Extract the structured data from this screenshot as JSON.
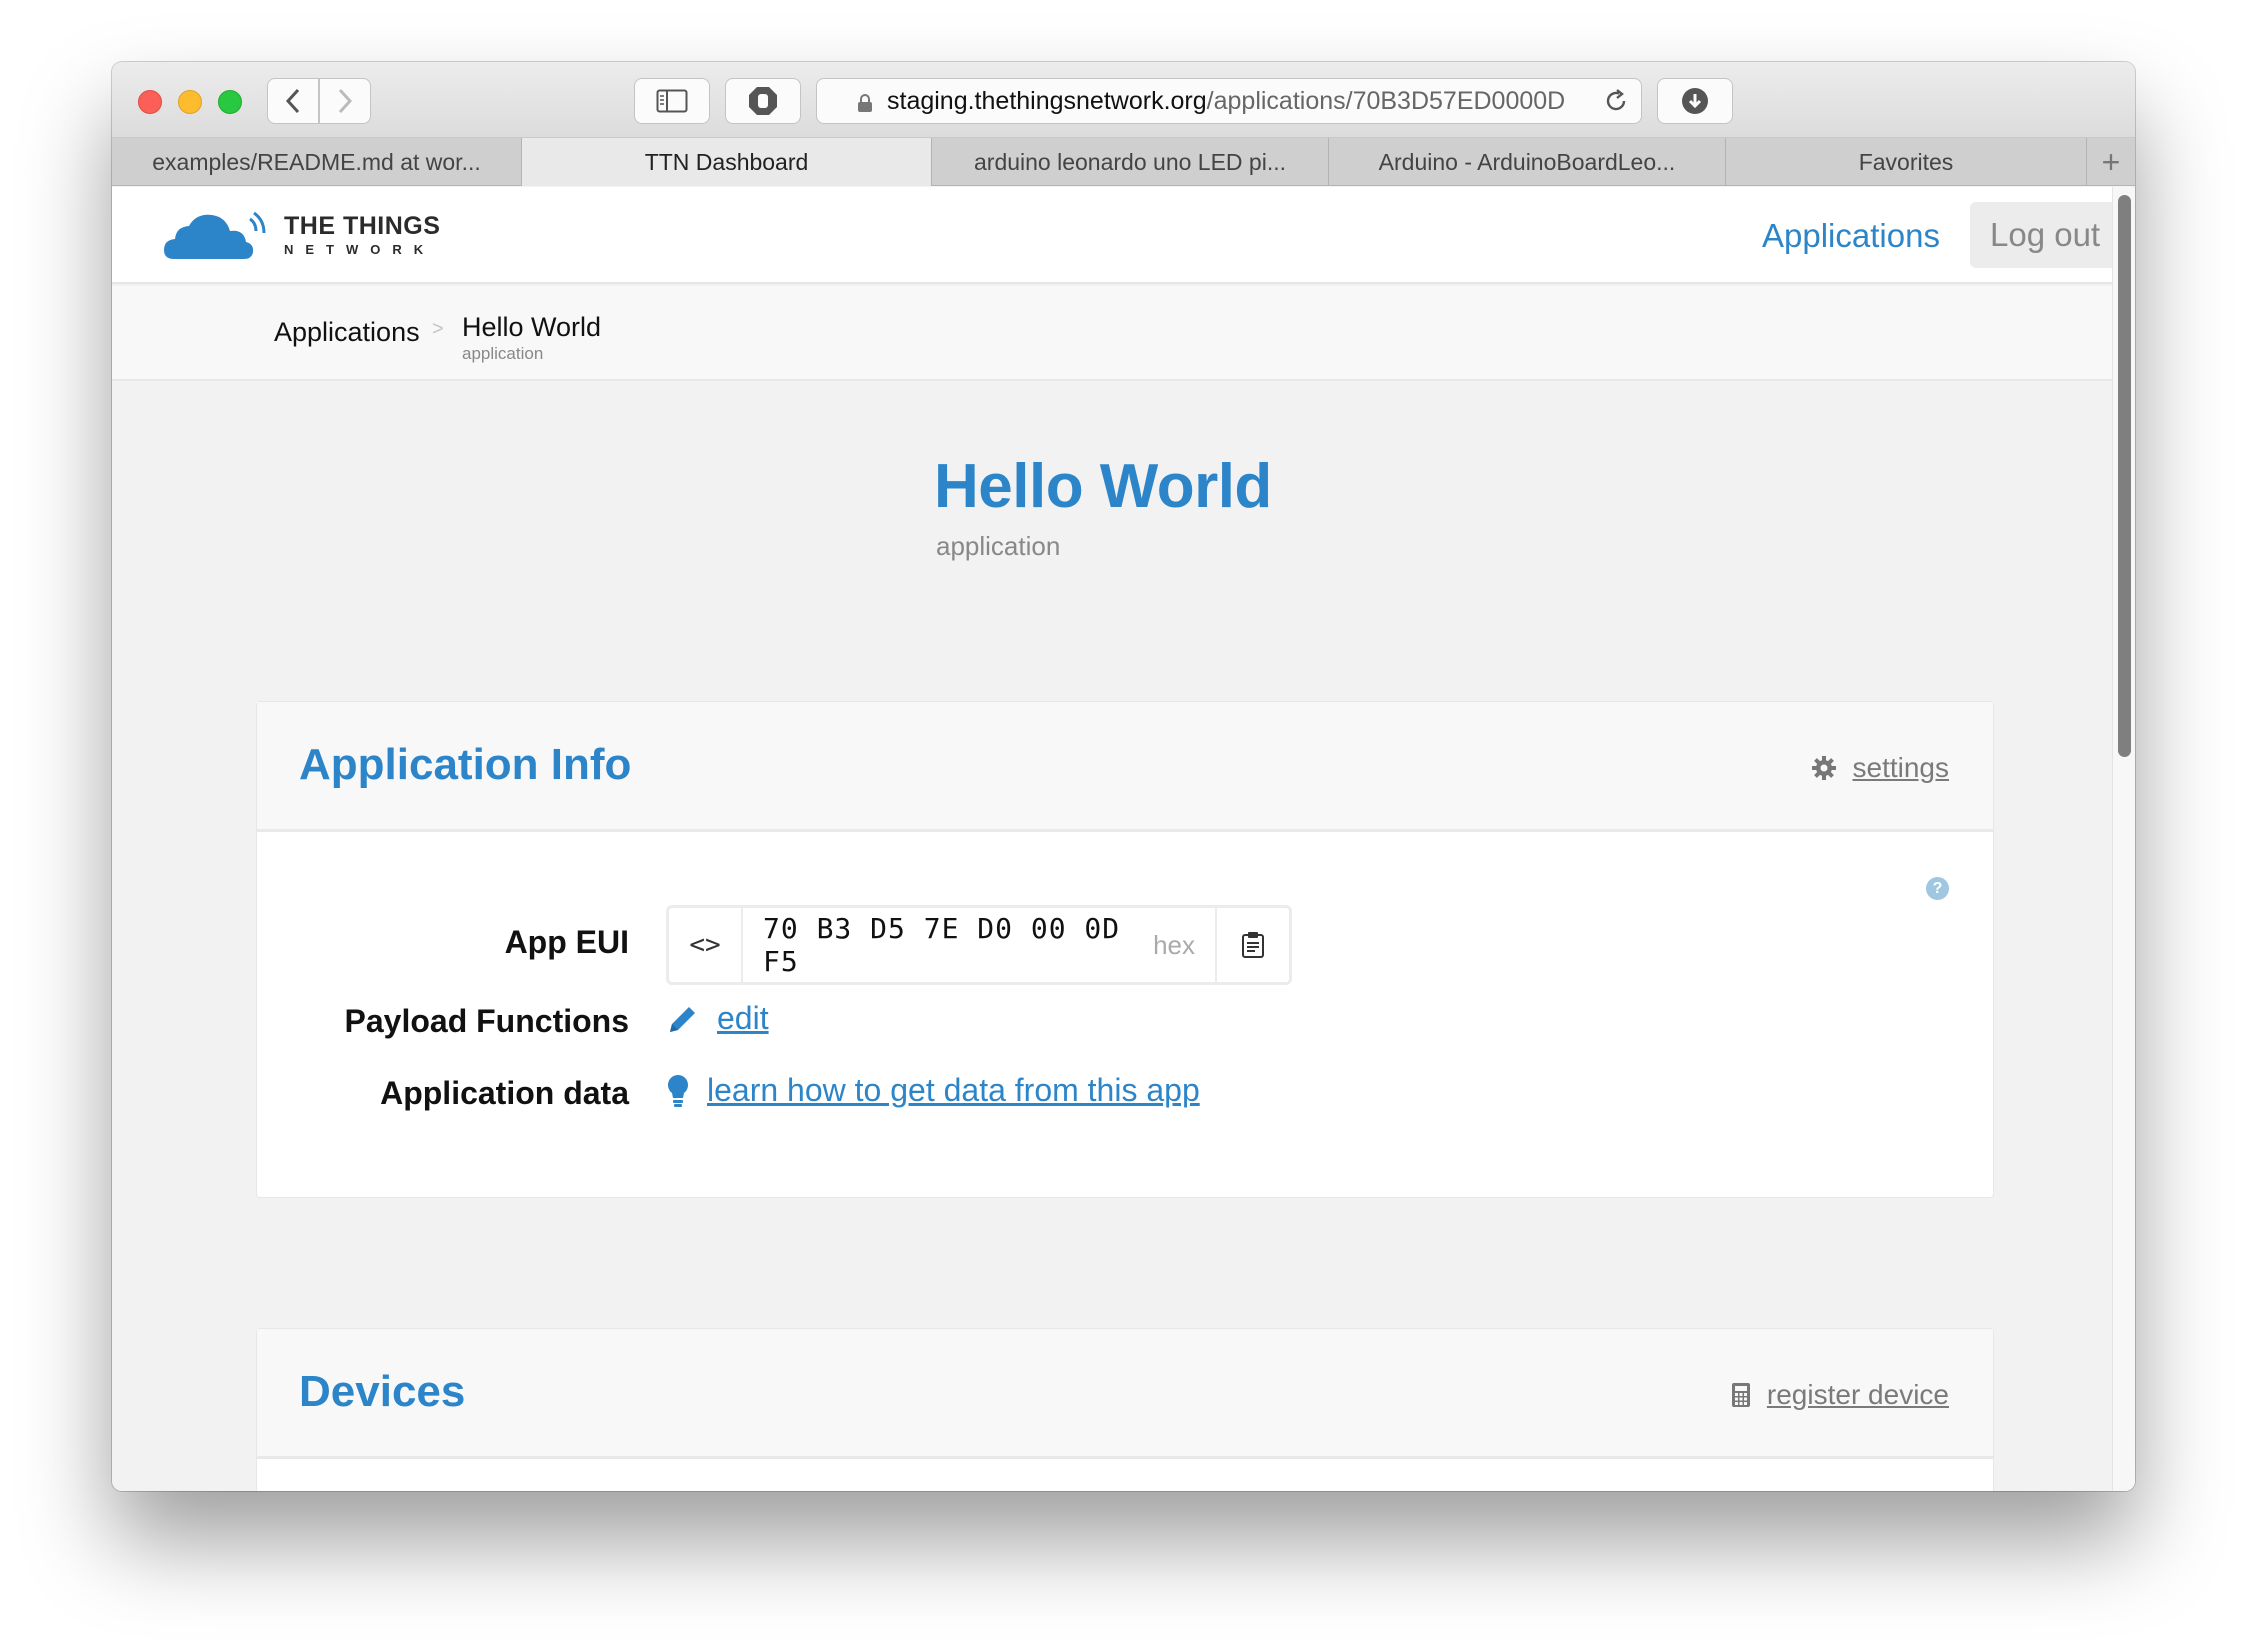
{
  "browser": {
    "url_host": "staging.thethingsnetwork.org",
    "url_path": "/applications/70B3D57ED0000D",
    "tabs": [
      {
        "label": "examples/README.md at wor...",
        "active": false
      },
      {
        "label": "TTN Dashboard",
        "active": true
      },
      {
        "label": "arduino leonardo uno LED pi...",
        "active": false
      },
      {
        "label": "Arduino - ArduinoBoardLeo...",
        "active": false
      },
      {
        "label": "Favorites",
        "active": false
      }
    ],
    "new_tab_label": "+"
  },
  "header": {
    "logo_line1": "THE THINGS",
    "logo_line2": "NETWORK",
    "nav_applications": "Applications",
    "nav_logout": "Log out"
  },
  "breadcrumb": {
    "root": "Applications",
    "separator": ">",
    "current": "Hello World",
    "current_sub": "application"
  },
  "hero": {
    "title": "Hello World",
    "subtitle": "application"
  },
  "app_info": {
    "title": "Application Info",
    "settings_label": "settings",
    "help": "?",
    "eui_label": "App EUI",
    "eui_toggle": "<>",
    "eui_value": "70 B3 D5 7E D0 00 0D F5",
    "eui_format": "hex",
    "payload_label": "Payload Functions",
    "payload_link": "edit",
    "data_label": "Application data",
    "data_link": "learn how to get data from this app"
  },
  "devices": {
    "title": "Devices",
    "register_label": "register device",
    "help": "?"
  },
  "colors": {
    "brand_blue": "#2d85c9",
    "help_blue": "#9fc7e2",
    "page_bg": "#f2f2f2"
  }
}
